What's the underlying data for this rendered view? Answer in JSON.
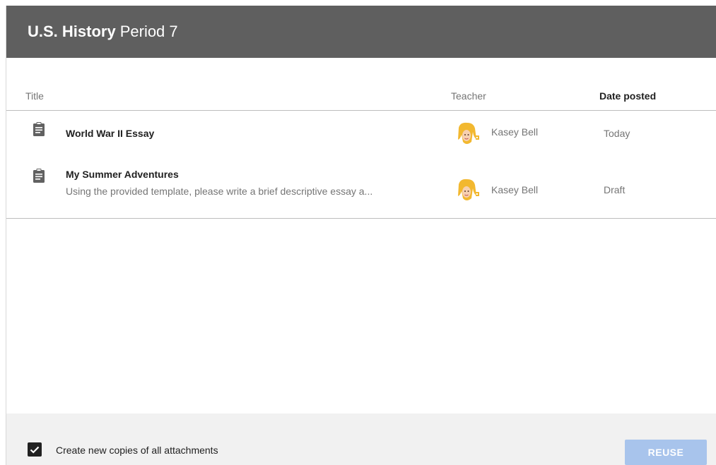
{
  "header": {
    "course": "U.S. History",
    "period": "Period 7",
    "background_color": "#5f5f5f"
  },
  "columns": {
    "title": "Title",
    "teacher": "Teacher",
    "date_posted": "Date posted"
  },
  "rows": [
    {
      "icon": "assignment-clipboard-icon",
      "title": "World War II Essay",
      "description": "",
      "teacher": "Kasey Bell",
      "date": "Today"
    },
    {
      "icon": "assignment-clipboard-icon",
      "title": "My Summer Adventures",
      "description": "Using the provided template, please write a brief descriptive essay a...",
      "teacher": "Kasey Bell",
      "date": "Draft"
    }
  ],
  "footer": {
    "checkbox_label": "Create new copies of all attachments",
    "checkbox_checked": true,
    "reuse_label": "REUSE",
    "reuse_color": "#a8c4ec"
  }
}
